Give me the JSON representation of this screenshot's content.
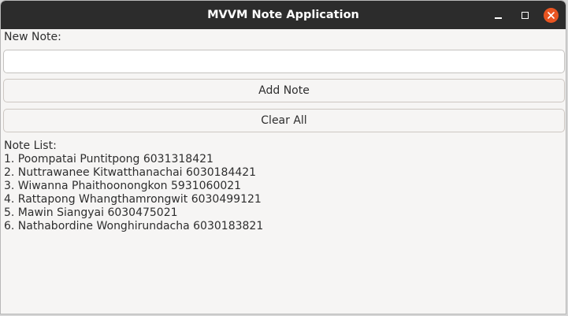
{
  "window": {
    "title": "MVVM Note Application",
    "minimize_icon": "minimize-icon",
    "maximize_icon": "maximize-icon",
    "close_icon": "close-icon",
    "close_color": "#e95420",
    "titlebar_color": "#2c2c2c"
  },
  "form": {
    "new_note_label": "New Note:",
    "new_note_value": "",
    "add_button_label": "Add Note",
    "clear_button_label": "Clear All"
  },
  "notes": {
    "label": "Note List:",
    "items": [
      "1. Poompatai Puntitpong 6031318421",
      "2. Nuttrawanee Kitwatthanachai 6030184421",
      "3. Wiwanna Phaithoonongkon 5931060021",
      "4. Rattapong Whangthamrongwit 6030499121",
      "5. Mawin Siangyai 6030475021",
      "6. Nathabordine Wonghirundacha 6030183821"
    ]
  }
}
